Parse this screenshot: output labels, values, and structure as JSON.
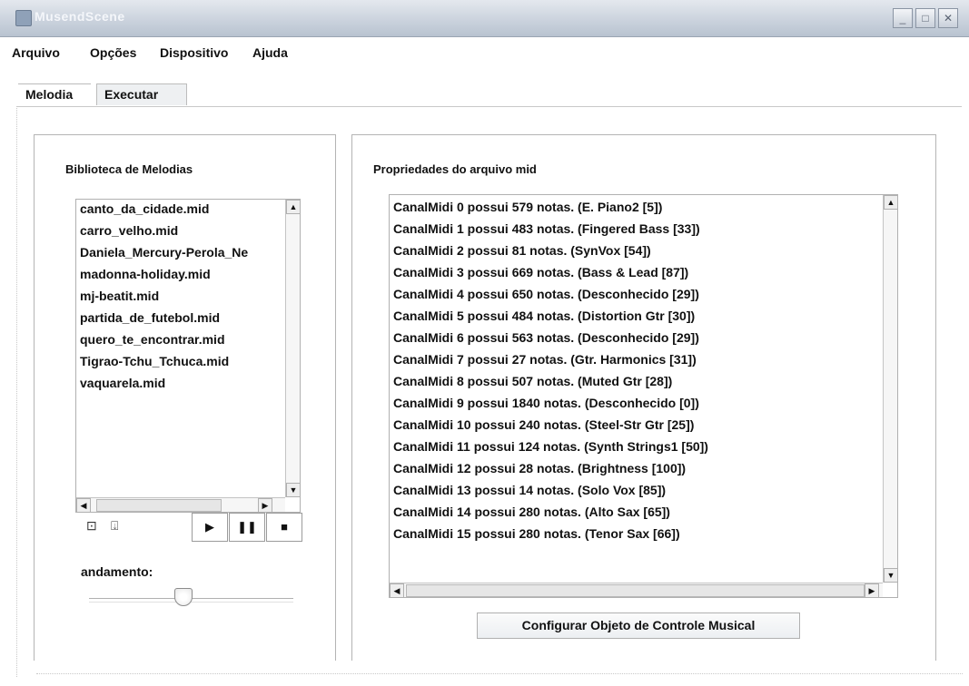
{
  "window": {
    "title": "MusendScene",
    "minimize_glyph": "_",
    "maximize_glyph": "□",
    "close_glyph": "✕"
  },
  "menu": [
    "Arquivo",
    "Opções",
    "Dispositivo",
    "Ajuda"
  ],
  "tabs": {
    "melodia": "Melodia",
    "executar": "Executar"
  },
  "library": {
    "label": "Biblioteca de Melodias",
    "items": [
      "canto_da_cidade.mid",
      "carro_velho.mid",
      "Daniela_Mercury-Perola_Ne",
      "madonna-holiday.mid",
      "mj-beatit.mid",
      "partida_de_futebol.mid",
      "quero_te_encontrar.mid",
      "Tigrao-Tchu_Tchuca.mid",
      "vaquarela.mid"
    ]
  },
  "controls": {
    "add_icon": "⊡",
    "remove_icon": "⍗",
    "play_glyph": "▶",
    "pause_glyph": "❚❚",
    "stop_glyph": "■"
  },
  "tempo": {
    "label": "andamento:",
    "value_fraction": 0.46
  },
  "properties": {
    "label": "Propriedades do arquivo mid",
    "items": [
      "CanalMidi 0 possui 579 notas. (E. Piano2 [5])",
      "CanalMidi 1 possui 483 notas. (Fingered Bass [33])",
      "CanalMidi 2 possui 81 notas. (SynVox [54])",
      "CanalMidi 3 possui 669 notas. (Bass & Lead [87])",
      "CanalMidi 4 possui 650 notas. (Desconhecido [29])",
      "CanalMidi 5 possui 484 notas. (Distortion Gtr [30])",
      "CanalMidi 6 possui 563 notas. (Desconhecido [29])",
      "CanalMidi 7 possui 27 notas. (Gtr. Harmonics [31])",
      "CanalMidi 8 possui 507 notas. (Muted Gtr [28])",
      "CanalMidi 9 possui 1840 notas. (Desconhecido [0])",
      "CanalMidi 10 possui 240 notas. (Steel-Str Gtr [25])",
      "CanalMidi 11 possui 124 notas. (Synth Strings1 [50])",
      "CanalMidi 12 possui 28 notas. (Brightness [100])",
      "CanalMidi 13 possui 14 notas. (Solo Vox [85])",
      "CanalMidi 14 possui 280 notas. (Alto Sax [65])",
      "CanalMidi 15 possui 280 notas. (Tenor Sax [66])"
    ]
  },
  "config_button": "Configurar Objeto de Controle Musical"
}
